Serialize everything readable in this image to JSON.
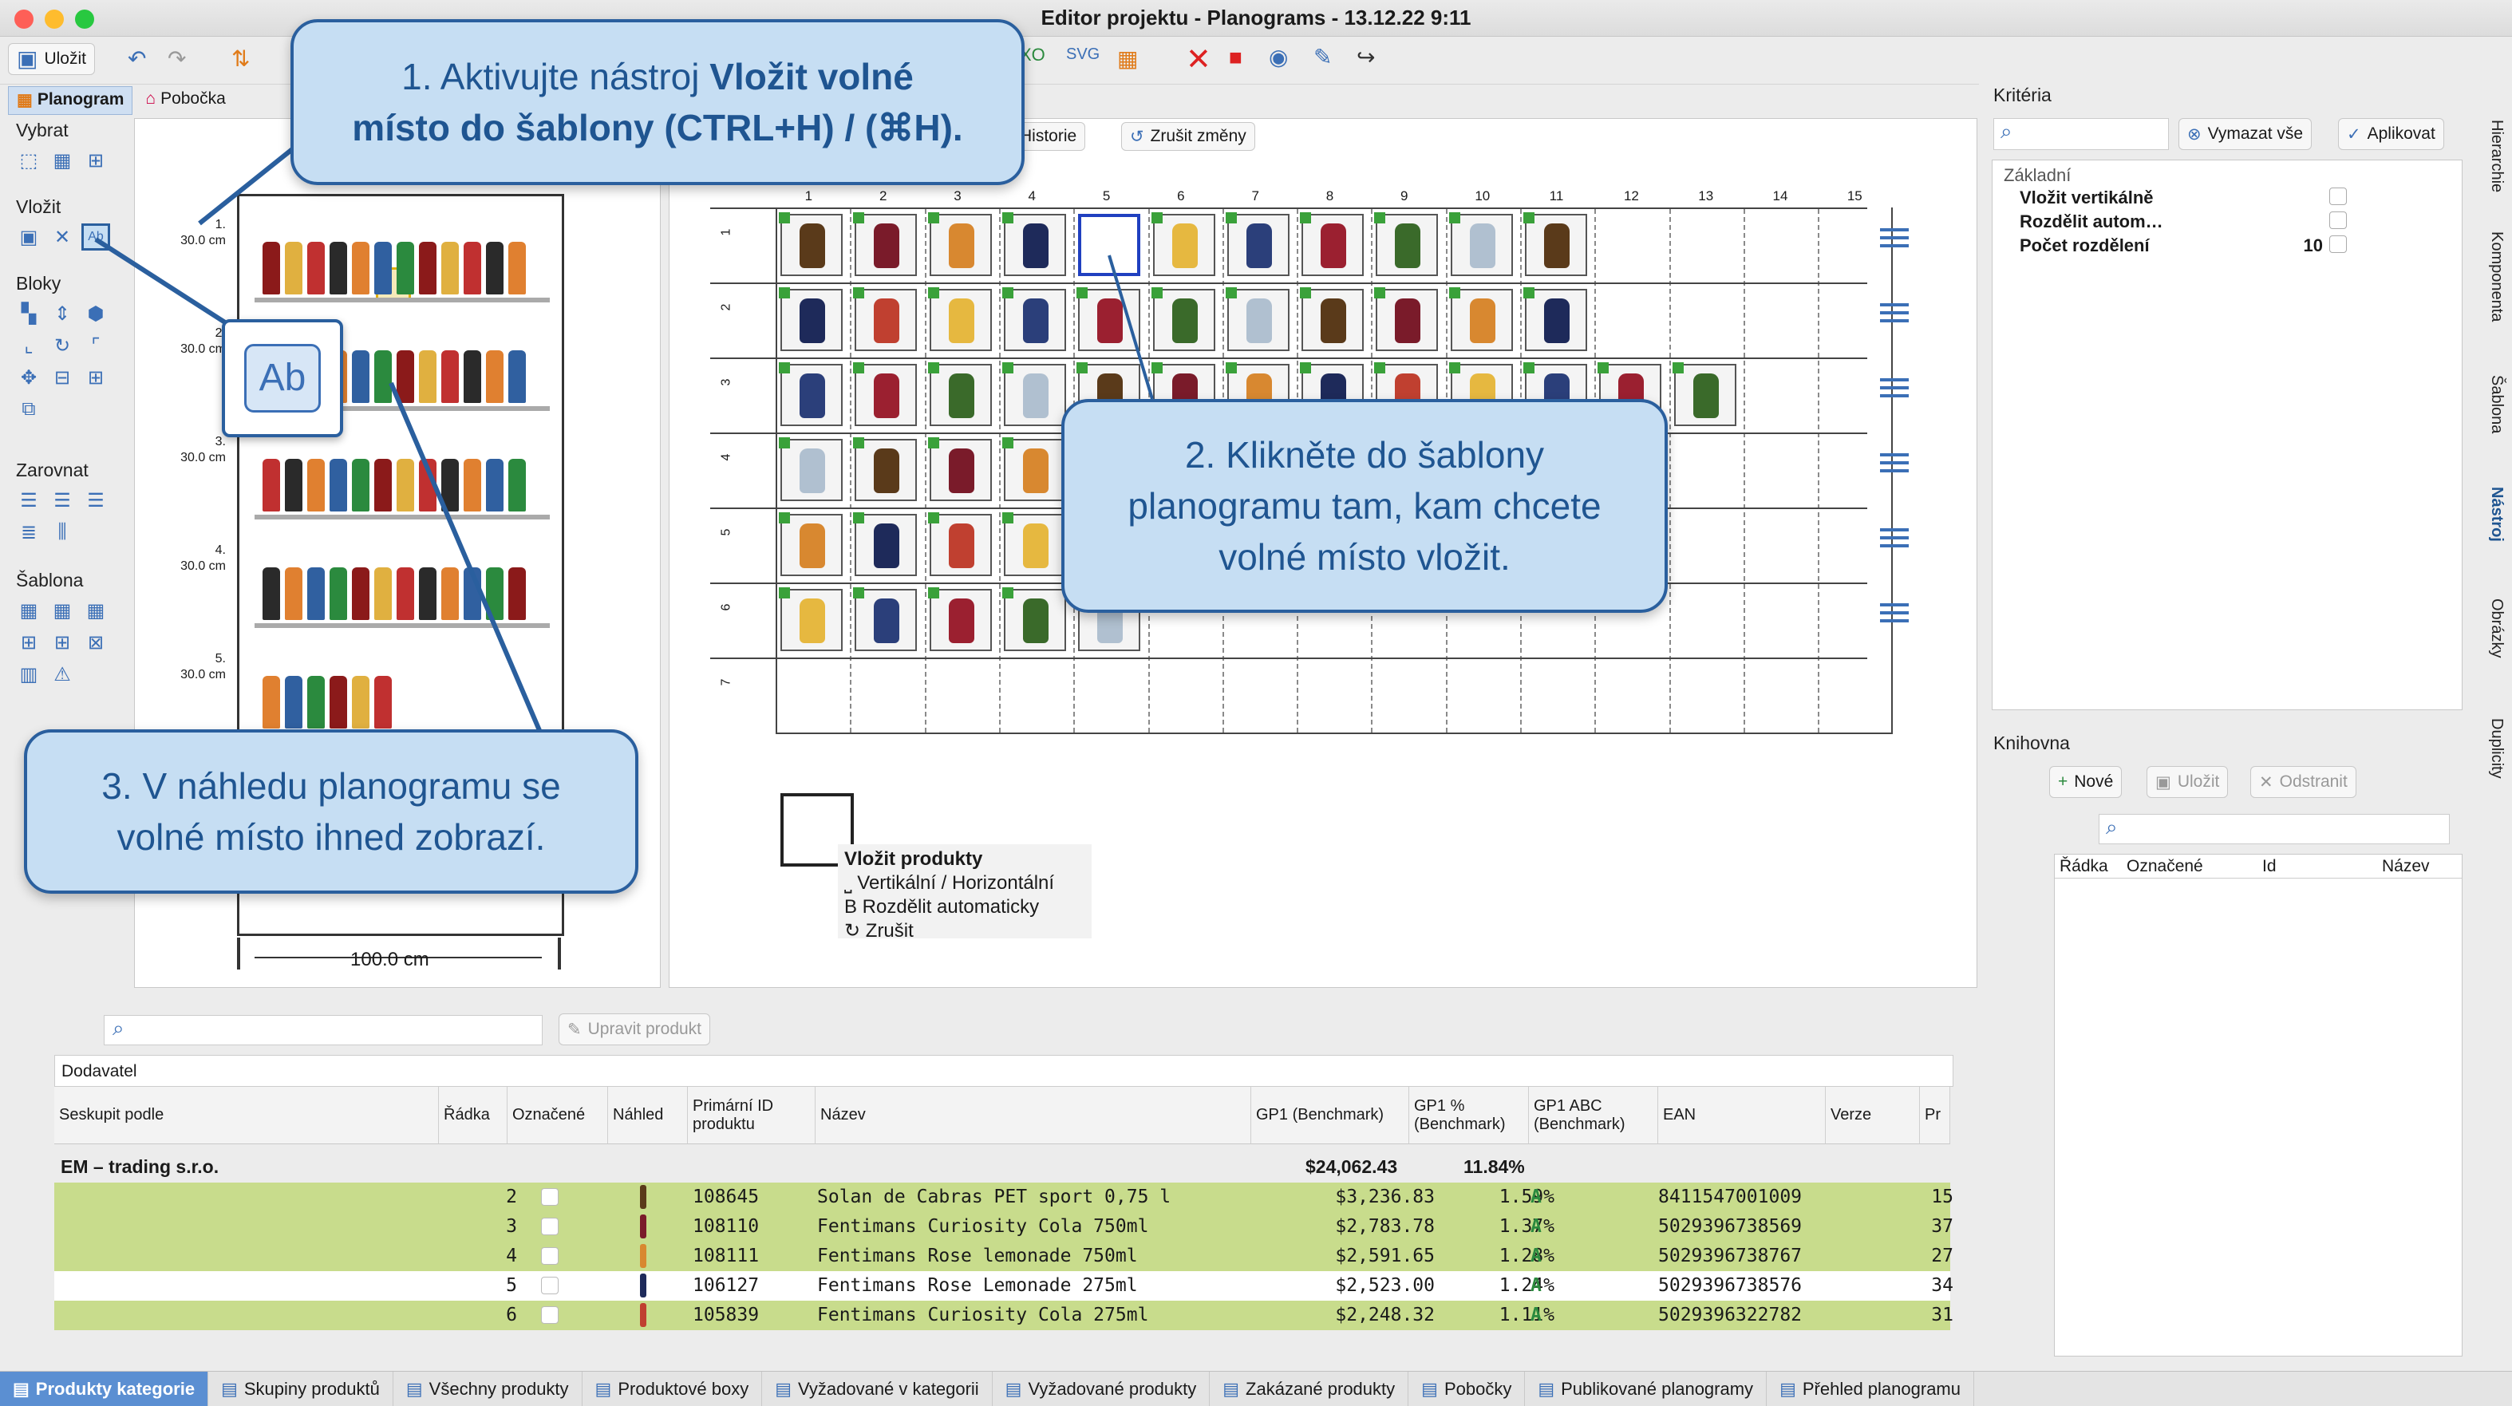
{
  "window": {
    "title": "Editor projektu - Planograms - 13.12.22 9:11"
  },
  "toolbar": {
    "save_label": "Uložit"
  },
  "view_tabs": {
    "planogram": "Planogram",
    "branch": "Pobočka"
  },
  "left_tools": {
    "select": "Vybrat",
    "insert": "Vložit",
    "blocks": "Bloky",
    "align": "Zarovnat",
    "template": "Šablona"
  },
  "preview": {
    "shelves": [
      {
        "n": "1.",
        "h": "30.0 cm"
      },
      {
        "n": "2.",
        "h": "30.0 cm"
      },
      {
        "n": "3.",
        "h": "30.0 cm"
      },
      {
        "n": "4.",
        "h": "30.0 cm"
      },
      {
        "n": "5.",
        "h": "30.0 cm"
      }
    ],
    "width_label": "100.0 cm"
  },
  "editor": {
    "history_label": "Historie",
    "undo_label": "Zrušit změny",
    "columns": [
      "1",
      "2",
      "3",
      "4",
      "5",
      "6",
      "7",
      "8",
      "9",
      "10",
      "11",
      "12",
      "13",
      "14",
      "15"
    ],
    "rows": [
      "1",
      "2",
      "3",
      "4",
      "5",
      "6",
      "7"
    ]
  },
  "context_menu": {
    "title": "Vložit produkty",
    "item1": "⎵ Vertikální / Horizontální",
    "item2": "B Rozdělit automaticky",
    "item3": "↻ Zrušit"
  },
  "criteria": {
    "title": "Kritéria",
    "clear_all": "Vymazat vše",
    "apply": "Aplikovat",
    "group": "Základní",
    "rows": [
      {
        "label": "Vložit vertikálně",
        "value": ""
      },
      {
        "label": "Rozdělit autom…",
        "value": ""
      },
      {
        "label": "Počet rozdělení",
        "value": "10"
      }
    ]
  },
  "library": {
    "title": "Knihovna",
    "new": "Nové",
    "save": "Uložit",
    "remove": "Odstranit",
    "cols": [
      "Řádka",
      "Označené",
      "Id",
      "Název"
    ]
  },
  "right_vtabs": [
    "Hierarchie",
    "Komponenta",
    "Šablona",
    "Nástroj",
    "Obrázky",
    "Duplicity"
  ],
  "bottom": {
    "edit_product": "Upravit produkt",
    "group_by_label": "Dodavatel",
    "group_row": {
      "name": "EM – trading s.r.o.",
      "gp1": "$24,062.43",
      "gp1pct": "11.84%"
    },
    "headers": [
      "Seskupit podle",
      "Řádka",
      "Označené",
      "Náhled",
      "Primární ID produktu",
      "Název",
      "GP1 (Benchmark)",
      "GP1 % (Benchmark)",
      "GP1 ABC (Benchmark)",
      "EAN",
      "Verze",
      "Pr"
    ],
    "rows": [
      {
        "row": "2",
        "id": "108645",
        "name": "Solan de Cabras PET sport 0,75 l",
        "gp1": "$3,236.83",
        "pct": "1.59%",
        "abc": "A",
        "ean": "8411547001009",
        "ver": "15",
        "hl": true
      },
      {
        "row": "3",
        "id": "108110",
        "name": "Fentimans Curiosity Cola 750ml",
        "gp1": "$2,783.78",
        "pct": "1.37%",
        "abc": "A",
        "ean": "5029396738569",
        "ver": "37",
        "hl": true
      },
      {
        "row": "4",
        "id": "108111",
        "name": "Fentimans Rose lemonade 750ml",
        "gp1": "$2,591.65",
        "pct": "1.28%",
        "abc": "A",
        "ean": "5029396738767",
        "ver": "27",
        "hl": true
      },
      {
        "row": "5",
        "id": "106127",
        "name": "Fentimans Rose Lemonade 275ml",
        "gp1": "$2,523.00",
        "pct": "1.24%",
        "abc": "A",
        "ean": "5029396738576",
        "ver": "34",
        "hl": false
      },
      {
        "row": "6",
        "id": "105839",
        "name": "Fentimans Curiosity Cola 275ml",
        "gp1": "$2,248.32",
        "pct": "1.11%",
        "abc": "A",
        "ean": "5029396322782",
        "ver": "31",
        "hl": true
      }
    ]
  },
  "tabs": [
    "Produkty kategorie",
    "Skupiny produktů",
    "Všechny produkty",
    "Produktové boxy",
    "Vyžadované v kategorii",
    "Vyžadované produkty",
    "Zakázané produkty",
    "Pobočky",
    "Publikované planogramy",
    "Přehled planogramu"
  ],
  "callouts": {
    "c1a": "1. Aktivujte nástroj ",
    "c1b": "Vložit volné",
    "c1c": "místo do šablony (CTRL+H) / (⌘H).",
    "c2": "2. Klikněte do šablony planogramu tam, kam chcete volné místo vložit.",
    "c3": "3. V náhledu planogramu se volné místo ihned zobrazí."
  },
  "tool_icon_text": "Ab"
}
